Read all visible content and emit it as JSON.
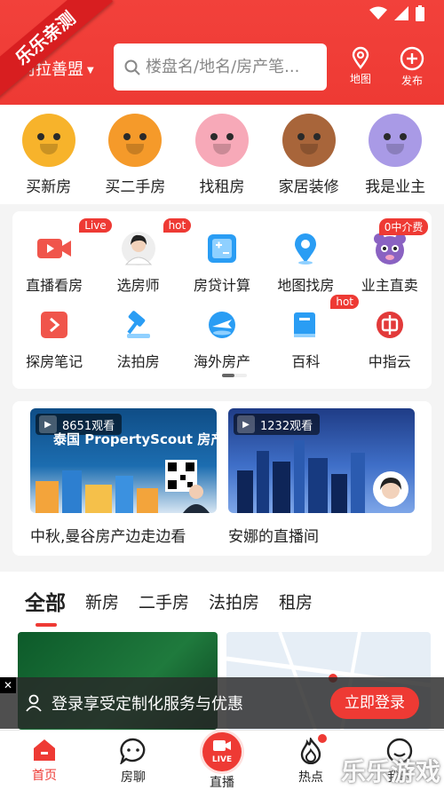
{
  "ribbon": "乐乐亲测",
  "header": {
    "city": "阿拉善盟",
    "search_placeholder": "楼盘名/地名/房产笔...",
    "map_label": "地图",
    "publish_label": "发布"
  },
  "categories": [
    {
      "label": "买新房",
      "icon": "ox-icon",
      "color": "#f7b32b"
    },
    {
      "label": "买二手房",
      "icon": "tiger-icon",
      "color": "#f59a2a"
    },
    {
      "label": "找租房",
      "icon": "pig-icon",
      "color": "#f7a9b8"
    },
    {
      "label": "家居装修",
      "icon": "cow-icon",
      "color": "#a8653a"
    },
    {
      "label": "我是业主",
      "icon": "rat-icon",
      "color": "#a99ae6"
    }
  ],
  "grid": {
    "row1": [
      {
        "label": "直播看房",
        "icon": "live-video-icon",
        "badge": "Live"
      },
      {
        "label": "选房师",
        "icon": "agent-avatar-icon",
        "badge": "hot"
      },
      {
        "label": "房贷计算",
        "icon": "calculator-icon",
        "badge": ""
      },
      {
        "label": "地图找房",
        "icon": "map-pin-icon",
        "badge": ""
      },
      {
        "label": "业主直卖",
        "icon": "owner-mascot-icon",
        "badge": "0中介费"
      }
    ],
    "row2": [
      {
        "label": "探房笔记",
        "icon": "notes-play-icon",
        "badge": ""
      },
      {
        "label": "法拍房",
        "icon": "gavel-icon",
        "badge": ""
      },
      {
        "label": "海外房产",
        "icon": "plane-icon",
        "badge": ""
      },
      {
        "label": "百科",
        "icon": "book-icon",
        "badge": "hot"
      },
      {
        "label": "中指云",
        "icon": "zhongzhi-logo-icon",
        "badge": ""
      }
    ]
  },
  "lives": [
    {
      "views": "8651观看",
      "title": "中秋,曼谷房产边走边看",
      "thumb_text": "泰国 PropertyScout 房产探"
    },
    {
      "views": "1232观看",
      "title": "安娜的直播间",
      "thumb_text": ""
    }
  ],
  "tabs": [
    "全部",
    "新房",
    "二手房",
    "法拍房",
    "租房"
  ],
  "login": {
    "close": "✕",
    "text": "登录享受定制化服务与优惠",
    "button": "立即登录"
  },
  "nav": [
    {
      "label": "首页",
      "icon": "home-icon"
    },
    {
      "label": "房聊",
      "icon": "chat-icon"
    },
    {
      "label": "直播",
      "icon": "live-icon",
      "live_text": "LIVE"
    },
    {
      "label": "热点",
      "icon": "flame-icon"
    },
    {
      "label": "我的",
      "icon": "profile-icon"
    }
  ],
  "watermark": "乐乐游戏",
  "colors": {
    "brand": "#ee3a34"
  }
}
